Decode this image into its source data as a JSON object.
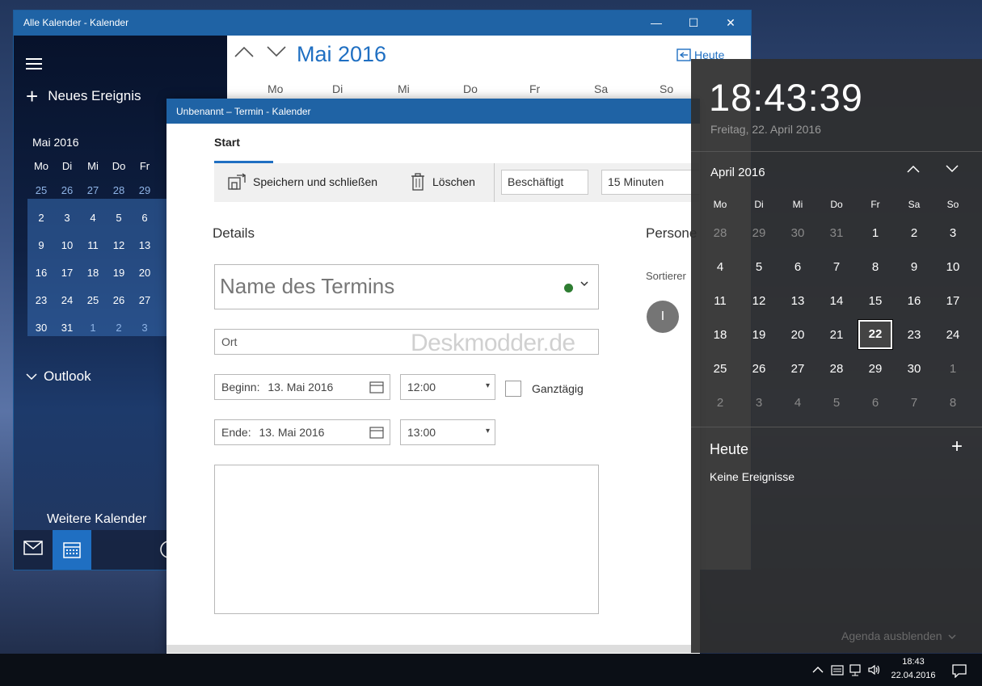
{
  "calendar_window": {
    "title": "Alle Kalender - Kalender",
    "controls": {
      "minimize": "—",
      "maximize": "☐",
      "close": "✕"
    },
    "sidebar": {
      "new_event": "Neues Ereignis",
      "mini_month": "Mai 2016",
      "weekdays": [
        "Mo",
        "Di",
        "Mi",
        "Do",
        "Fr"
      ],
      "rows": [
        [
          "25",
          "26",
          "27",
          "28",
          "29"
        ],
        [
          "2",
          "3",
          "4",
          "5",
          "6"
        ],
        [
          "9",
          "10",
          "11",
          "12",
          "13"
        ],
        [
          "16",
          "17",
          "18",
          "19",
          "20"
        ],
        [
          "23",
          "24",
          "25",
          "26",
          "27"
        ],
        [
          "30",
          "31",
          "1",
          "2",
          "3"
        ]
      ],
      "outlook": "Outlook",
      "more_calendars": "Weitere Kalender"
    },
    "main": {
      "month_title": "Mai 2016",
      "today_button": "Heute",
      "weekdays": [
        "Mo",
        "Di",
        "Mi",
        "Do",
        "Fr",
        "Sa",
        "So"
      ]
    }
  },
  "event_window": {
    "title": "Unbenannt – Termin - Kalender",
    "tab_start": "Start",
    "toolbar": {
      "save_close": "Speichern und schließen",
      "delete": "Löschen",
      "show_as": "Beschäftigt",
      "reminder": "15 Minuten"
    },
    "details_heading": "Details",
    "people_heading": "Persone",
    "sort_label": "Sortierer",
    "person_initial": "I",
    "event_name_placeholder": "Name des Termins",
    "location_placeholder": "Ort",
    "watermark": "Deskmodder.de",
    "start": {
      "label": "Beginn:",
      "date": "13. Mai 2016",
      "time": "12:00"
    },
    "end": {
      "label": "Ende:",
      "date": "13. Mai 2016",
      "time": "13:00"
    },
    "all_day": "Ganztägig"
  },
  "flyout": {
    "time": "18:43:39",
    "long_date": "Freitag, 22. April 2016",
    "month": "April 2016",
    "weekdays": [
      "Mo",
      "Di",
      "Mi",
      "Do",
      "Fr",
      "Sa",
      "So"
    ],
    "rows": [
      [
        "28",
        "29",
        "30",
        "31",
        "1",
        "2",
        "3"
      ],
      [
        "4",
        "5",
        "6",
        "7",
        "8",
        "9",
        "10"
      ],
      [
        "11",
        "12",
        "13",
        "14",
        "15",
        "16",
        "17"
      ],
      [
        "18",
        "19",
        "20",
        "21",
        "22",
        "23",
        "24"
      ],
      [
        "25",
        "26",
        "27",
        "28",
        "29",
        "30",
        "1"
      ],
      [
        "2",
        "3",
        "4",
        "5",
        "6",
        "7",
        "8"
      ]
    ],
    "today_heading": "Heute",
    "no_events": "Keine Ereignisse",
    "hide_agenda": "Agenda ausblenden"
  },
  "taskbar": {
    "time": "18:43",
    "date": "22.04.2016"
  },
  "colors": {
    "accent": "#1f6fc2",
    "titlebar": "#1f63a5",
    "calendar_dot": "#2e7d32"
  }
}
